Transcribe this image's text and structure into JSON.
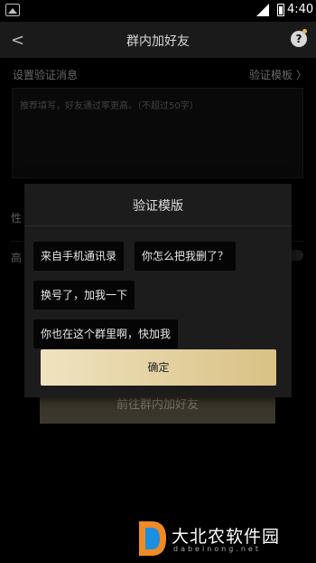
{
  "status_bar": {
    "time": "4:40"
  },
  "top_bar": {
    "back_label": "<",
    "title": "群内加好友",
    "help_label": "?"
  },
  "verify": {
    "section_label": "设置验证消息",
    "template_link": "验证模板 〉",
    "placeholder": "推荐填写，好友通过率更高。（不超过50字）"
  },
  "background": {
    "gender_label": "性",
    "hi_label": "高",
    "cta_label": "前往群内加好友"
  },
  "dialog": {
    "title": "验证模版",
    "templates": [
      "来自手机通讯录",
      "你怎么把我删了？",
      "换号了，加我一下",
      "你也在这个群里啊，快加我"
    ],
    "confirm_label": "确定"
  },
  "watermark": {
    "text": "大北农软件园",
    "sub": "dabeinong.net"
  },
  "colors": {
    "accent_gold": "#e0c98f",
    "background": "#000000",
    "dialog": "#1c1c1c"
  }
}
